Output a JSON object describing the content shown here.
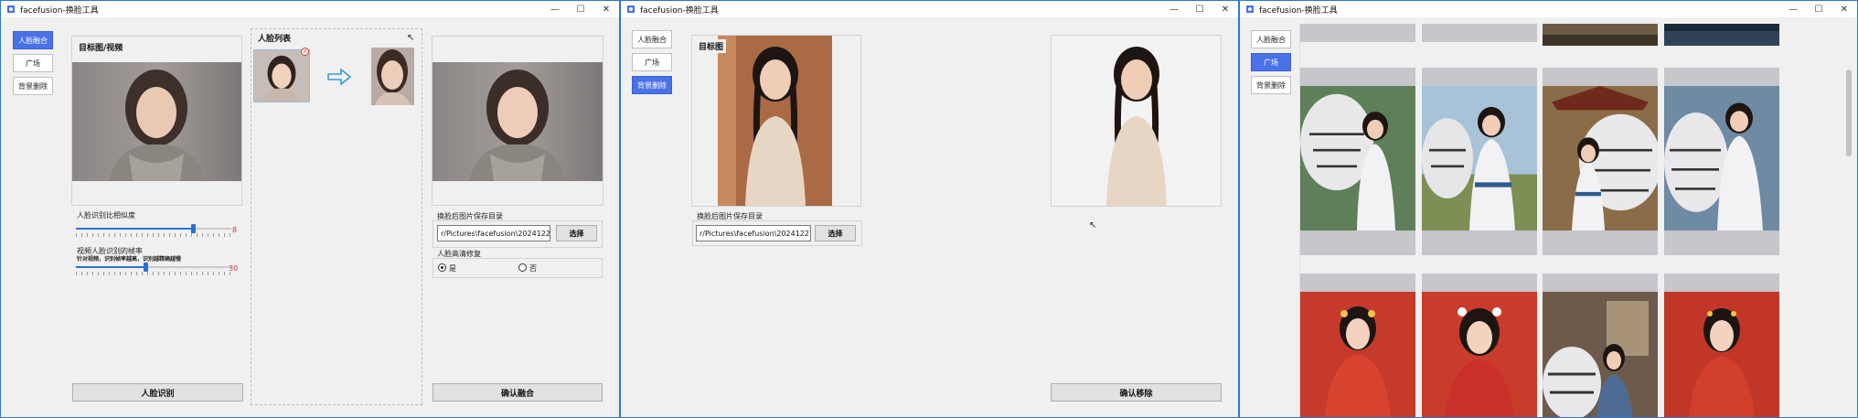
{
  "window_title": "facefusion-换脸工具",
  "nav": {
    "face_fusion": "人脸融合",
    "plaza": "广场",
    "bg_remove": "背景删除"
  },
  "w1": {
    "target_label": "目标图/视频",
    "face_list_label": "人脸列表",
    "ratio_label": "人脸识别比相似度",
    "ratio_value": "8",
    "ratio_level": 0.82,
    "fps_label": "视频人脸识别的帧率",
    "fps_hint": "针对视频，识别帧率越高，识别越精确越慢",
    "fps_value": "30",
    "fps_level": 0.48,
    "save_dir_label": "换脸后图片保存目录",
    "save_dir_value": "r/Pictures\\facefusion\\20241227",
    "choose_button": "选择",
    "enhance_label": "人脸高清修复",
    "yes": "是",
    "no": "否",
    "detect_button": "人脸识别",
    "confirm_fusion_button": "确认融合"
  },
  "w2": {
    "target_label": "目标图",
    "save_dir_label": "换脸后图片保存目录",
    "save_dir_value": "r/Pictures\\facefusion\\20241227",
    "choose_button": "选择",
    "confirm_remove_button": "确认移除"
  },
  "colors": {
    "accent": "#4a72e8",
    "window_border": "#2b78d4",
    "value_red": "#d23b3b"
  }
}
